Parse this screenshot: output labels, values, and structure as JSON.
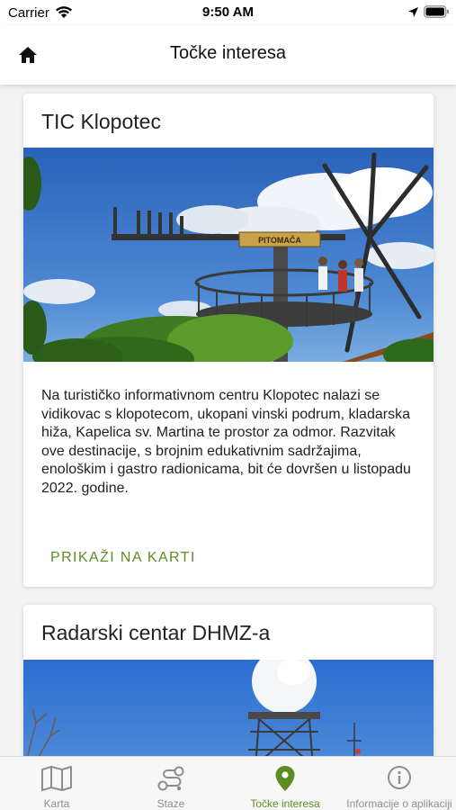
{
  "status_bar": {
    "carrier": "Carrier",
    "time": "9:50 AM"
  },
  "header": {
    "title": "Točke interesa"
  },
  "cards": [
    {
      "title": "TIC Klopotec",
      "image_sign_text": "PITOMAČA",
      "description": "Na turističko informativnom centru Klopotec nalazi se vidikovac s klopotecom, ukopani vinski podrum, kladarska hiža, Kapelica sv. Martina te prostor za odmor. Razvitak ove destinacije, s brojnim edukativnim sadržajima, enološkim i gastro radionicama, bit će dovršen u listopadu 2022. godine.",
      "action_label": "PRIKAŽI NA KARTI"
    },
    {
      "title": "Radarski centar DHMZ-a"
    }
  ],
  "tabs": [
    {
      "label": "Karta",
      "icon": "map-icon",
      "active": false
    },
    {
      "label": "Staze",
      "icon": "route-icon",
      "active": false
    },
    {
      "label": "Točke interesa",
      "icon": "location-pin-icon",
      "active": true
    },
    {
      "label": "Informacije o aplikaciji",
      "icon": "info-icon",
      "active": false
    }
  ],
  "colors": {
    "accent": "#5e8c22",
    "inactive": "#8e8e8e"
  }
}
